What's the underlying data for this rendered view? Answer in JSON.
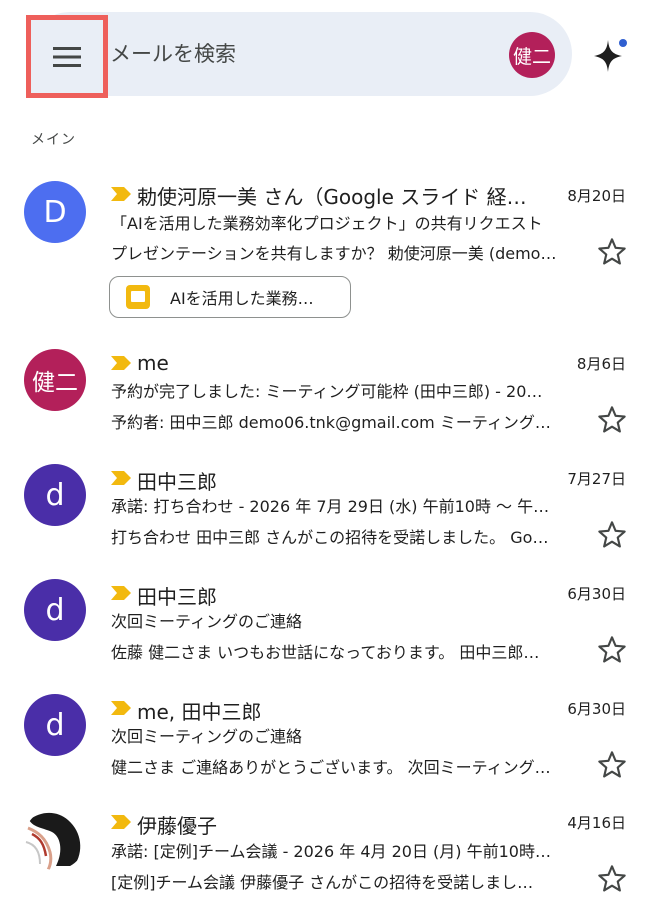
{
  "search": {
    "placeholder": "メールを検索",
    "account_initials": "健二"
  },
  "section": {
    "label": "メイン"
  },
  "chip": {
    "label": "AIを活用した業務…"
  },
  "colors": {
    "avatar_blue": "#4d6ef0",
    "avatar_purple": "#4a2ea8",
    "avatar_magenta": "#b3205a",
    "importance": "#f2b90f"
  },
  "emails": [
    {
      "avatar": "D",
      "sender": "勅使河原一美 さん（Google スライド 経…",
      "date": "8月20日",
      "subject": "「AIを活用した業務効率化プロジェクト」の共有リクエスト",
      "snippet": "プレゼンテーションを共有しますか？ 勅使河原一美 (demo…"
    },
    {
      "avatar": "健二",
      "sender": "me",
      "date": "8月6日",
      "subject": "予約が完了しました: ミーティング可能枠 (田中三郎) - 20…",
      "snippet": "予約者: 田中三郎 demo06.tnk@gmail.com ミーティング…"
    },
    {
      "avatar": "d",
      "sender": "田中三郎",
      "date": "7月27日",
      "subject": "承諾: 打ち合わせ - 2026 年 7月 29日 (水) 午前10時 ～ 午…",
      "snippet": "打ち合わせ 田中三郎 さんがこの招待を受諾しました。 Go…"
    },
    {
      "avatar": "d",
      "sender": "田中三郎",
      "date": "6月30日",
      "subject": "次回ミーティングのご連絡",
      "snippet": "佐藤 健二さま いつもお世話になっております。 田中三郎…"
    },
    {
      "avatar": "d",
      "sender": "me, 田中三郎",
      "date": "6月30日",
      "subject": "次回ミーティングのご連絡",
      "snippet": "健二さま ご連絡ありがとうございます。 次回ミーティング…"
    },
    {
      "avatar": "",
      "sender": "伊藤優子",
      "date": "4月16日",
      "subject": "承諾: [定例]チーム会議 - 2026 年 4月 20日 (月) 午前10時…",
      "snippet": "[定例]チーム会議 伊藤優子 さんがこの招待を受諾しまし…"
    }
  ]
}
